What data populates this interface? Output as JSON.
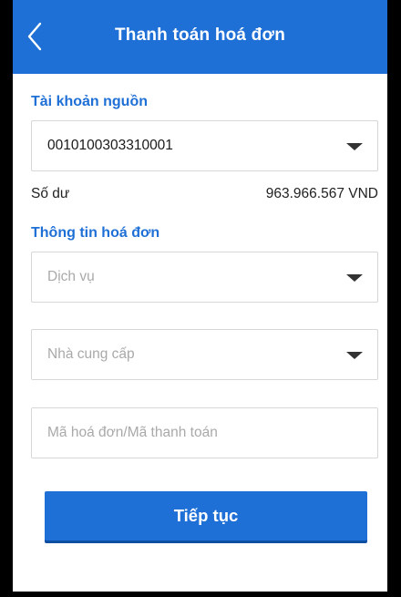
{
  "header": {
    "title": "Thanh toán hoá đơn",
    "back_icon": "chevron-left-icon"
  },
  "source_account": {
    "section_label": "Tài khoản nguồn",
    "account_number": "0010100303310001",
    "balance_label": "Số dư",
    "balance_value": "963.966.567 VND"
  },
  "bill_info": {
    "section_label": "Thông tin hoá đơn",
    "service_placeholder": "Dịch vụ",
    "provider_placeholder": "Nhà cung cấp",
    "bill_code_placeholder": "Mã hoá đơn/Mã thanh toán"
  },
  "actions": {
    "continue_label": "Tiếp tục"
  },
  "colors": {
    "accent": "#1e6fd6",
    "placeholder_text": "#a9a9a9",
    "field_border": "#d7d7d7"
  }
}
